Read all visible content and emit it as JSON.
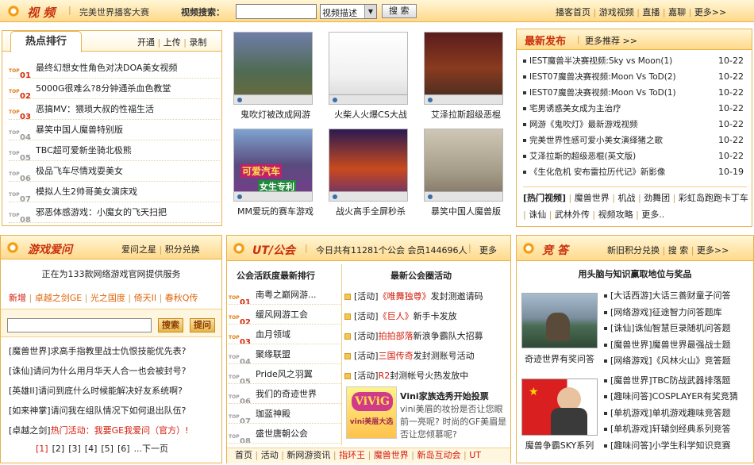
{
  "topbar": {
    "title": "视 频",
    "tagline": "完美世界播客大赛",
    "search_label": "视频搜索：",
    "search_value": "",
    "select_value": "视频描述",
    "search_button": "搜 索",
    "nav": [
      "播客首页",
      "游戏视频",
      "直播",
      "嘉聊",
      "更多>>"
    ]
  },
  "hot": {
    "title": "热点排行",
    "links": [
      "开通",
      "上传",
      "录制"
    ],
    "items": [
      {
        "rank": "01",
        "text": "最终幻想女性角色对决DOA美女视频"
      },
      {
        "rank": "02",
        "text": "5000G很难么?8分钟通杀血色教堂"
      },
      {
        "rank": "03",
        "text": "恶搞MV：猥琐大叔的性福生活"
      },
      {
        "rank": "04",
        "text": "暴笑中国人魔兽特别版"
      },
      {
        "rank": "05",
        "text": "TBC超可爱新坐骑北极熊"
      },
      {
        "rank": "06",
        "text": "极品飞车尽情戏耍美女"
      },
      {
        "rank": "07",
        "text": "模拟人生2帅哥美女演床戏"
      },
      {
        "rank": "08",
        "text": "邪恶体感游戏：小魔女的飞天扫把"
      }
    ],
    "top_label": "TOP"
  },
  "videos": [
    {
      "caption": "鬼吹灯被改成网游"
    },
    {
      "caption": "火柴人火爆CS大战"
    },
    {
      "caption": "艾泽拉斯超级恶棍"
    },
    {
      "caption": "MM爱玩的赛车游戏"
    },
    {
      "caption": "战火高手全屏秒杀"
    },
    {
      "caption": "暴笑中国人魔兽版"
    }
  ],
  "thumb_texts": {
    "car_top": "可爱汽车",
    "car_bottom": "女生专利"
  },
  "latest": {
    "title": "最新发布",
    "more": "更多推荐 >>",
    "items": [
      {
        "text": "IEST魔兽半决赛视频:Sky vs Moon(1)",
        "date": "10-22"
      },
      {
        "text": "IEST07魔兽决赛视频:Moon Vs ToD(2)",
        "date": "10-22"
      },
      {
        "text": "IEST07魔兽决赛视频:Moon Vs ToD(1)",
        "date": "10-22"
      },
      {
        "text": "宅男诱惑美女成为主治疗",
        "date": "10-22"
      },
      {
        "text": "网游《鬼吹灯》最新游戏视频",
        "date": "10-22"
      },
      {
        "text": "完美世界性感可爱小美女演绎猪之歌",
        "date": "10-22"
      },
      {
        "text": "艾泽拉斯的超级恶棍(英文版)",
        "date": "10-22"
      },
      {
        "text": "《生化危机 安布雷拉历代记》新影像",
        "date": "10-19"
      }
    ],
    "tags_label": "[热门视频]",
    "tags": [
      "魔兽世界",
      "机战",
      "劲舞团",
      "彩虹岛",
      "跑跑卡丁车",
      "诛仙",
      "武林外传",
      "视频攻略",
      "更多.."
    ]
  },
  "gamelove": {
    "title": "游戏爱问",
    "links": [
      "爱问之星",
      "积分兑换"
    ],
    "service": "正在为133款网络游戏官网提供服务",
    "games": [
      "新增",
      "卓越之剑GE",
      "光之国度",
      "倚天II",
      "春秋Q传"
    ],
    "search_value": "",
    "search_btn": "搜索",
    "ask_btn": "提问",
    "questions": [
      {
        "tag": "[魔兽世界]",
        "text": "求高手指教里战士仇恨技能优先表?"
      },
      {
        "tag": "[诛仙]",
        "text": "请问为什么用月华天人合一也会被封号?"
      },
      {
        "tag": "[英雄II]",
        "text": "请问到底什么时候能解决好友系统啊?"
      },
      {
        "tag": "[如来神掌]",
        "text": "请问我在组队情况下如何退出队伍?"
      },
      {
        "tag": "[卓越之剑]",
        "text": "热门活动：我要GE我爱问（官方）!"
      }
    ],
    "pages": [
      "[1]",
      "[2]",
      "[3]",
      "[4]",
      "[5]",
      "[6]",
      "...下一页"
    ]
  },
  "guild": {
    "title": "UT/公会",
    "stats": "今日共有11281个公会 会员144696人",
    "more": "更多",
    "rank_title": "公会活跃度最新排行",
    "act_title": "最新公会圈活动",
    "rank": [
      {
        "rank": "01",
        "name": "南粤之巅网游..."
      },
      {
        "rank": "02",
        "name": "缓风网游工会"
      },
      {
        "rank": "03",
        "name": "血月领域"
      },
      {
        "rank": "04",
        "name": "聚缘联盟"
      },
      {
        "rank": "05",
        "name": "Pride风之羽翼"
      },
      {
        "rank": "06",
        "name": "我们的奇迹世界"
      },
      {
        "rank": "07",
        "name": "珈蓝神殿"
      },
      {
        "rank": "08",
        "name": "盛世唐朝公会"
      }
    ],
    "acts": [
      {
        "tag": "[活动]",
        "hl": "《唯舞独尊》",
        "rest": "发封测邀请码"
      },
      {
        "tag": "[活动]",
        "hl": "《巨人》",
        "rest": "新手卡发放"
      },
      {
        "tag": "[活动]",
        "hl": "拍拍部落",
        "rest": "新浪争霸队大招募"
      },
      {
        "tag": "[活动]",
        "hl": "三国传奇",
        "rest": "发封测账号活动"
      },
      {
        "tag": "[活动]",
        "hl": "R2",
        "rest": "封测帐号火热发放中"
      }
    ],
    "feature_title": "Vini家族选秀开始投票",
    "feature_text": "vini美眉的妆扮是否让您眼前一亮呢? 时尚的GF美眉是否让您倾慕呢?",
    "feature_img_text": "vini美眉大选",
    "footer": [
      "首页",
      "活动",
      "新网游资讯",
      "指环王",
      "魔兽世界",
      "新岛互动会",
      "UT"
    ]
  },
  "quiz": {
    "title": "竞 答",
    "links": [
      "新旧积分兑换",
      "搜 索",
      "更多>>"
    ],
    "subtitle": "用头脑与知识赢取地位与奖品",
    "img1_caption": "奇迹世界有奖问答",
    "img2_caption": "魔兽争霸SKY系列",
    "items": [
      {
        "tag": "[大话西游]",
        "text": "大话三善财童子问答"
      },
      {
        "tag": "[网络游戏]",
        "text": "征途智力问答题库"
      },
      {
        "tag": "[诛仙]",
        "text": "诛仙智慧巨录随机问答题"
      },
      {
        "tag": "[魔兽世界]",
        "text": "魔兽世界最强战士题"
      },
      {
        "tag": "[网络游戏]",
        "text": "《风林火山》竞答题"
      },
      {
        "tag": "[魔兽世界]",
        "text": "TBC防战武器排落题"
      },
      {
        "tag": "[趣味问答]",
        "text": "COSPLAYER有奖竞猜"
      },
      {
        "tag": "[单机游戏]",
        "text": "单机游戏趣味竞答题"
      },
      {
        "tag": "[单机游戏]",
        "text": "轩辕剑经典系列竞答"
      },
      {
        "tag": "[趣味问答]",
        "text": "小学生科学知识竞赛"
      }
    ]
  },
  "colors": {
    "accent": "#c8300b",
    "border": "#e6b34f",
    "header_bg": "#ffd98a"
  }
}
